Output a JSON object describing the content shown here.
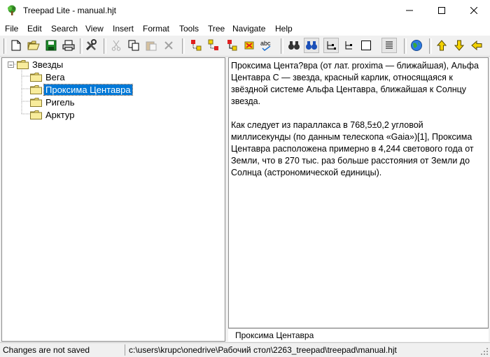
{
  "window": {
    "title": "Treepad Lite - manual.hjt"
  },
  "menu": [
    "File",
    "Edit",
    "Search",
    "View",
    "Insert",
    "Format",
    "Tools",
    "Tree",
    "Navigate",
    "Help"
  ],
  "toolbar": {
    "icons": [
      "new-file-icon",
      "open-folder-icon",
      "save-icon",
      "print-icon",
      "tools-icon",
      "cut-icon",
      "copy-icon",
      "paste-icon",
      "delete-icon",
      "insert-node-before-icon",
      "insert-node-after-icon",
      "insert-child-icon",
      "delete-node-icon",
      "spellcheck-icon",
      "find-icon",
      "find-next-icon",
      "tree-layout-icon",
      "tree-layout-2-icon",
      "single-pane-icon",
      "article-pane-icon",
      "web-icon",
      "move-up-icon",
      "move-down-icon",
      "move-left-icon"
    ],
    "spellcheck_label": "abc"
  },
  "tree": {
    "root": "Звезды",
    "children": [
      "Вега",
      "Проксима Центавра",
      "Ригель",
      "Арктур"
    ],
    "selected": "Проксима Центавра",
    "expander": "−"
  },
  "article": {
    "paragraphs": [
      "Проксима Цента?вра (от лат. proxima — ближайшая), Альфа Центавра C — звезда, красный карлик, относящаяся к звёздной системе Альфа Центавра, ближайшая к Солнцу звезда.",
      "Как следует из параллакса в 768,5±0,2 угловой миллисекунды (по данным телескопа «Gaia»)[1], Проксима Центавра расположена примерно в 4,244 светового года от Земли, что в 270 тыс. раз больше расстояния от Земли до Солнца (астрономической единицы)."
    ]
  },
  "node_caption": "Проксима Центавра",
  "status": {
    "left": "Changes are not saved",
    "path": "c:\\users\\krupc\\onedrive\\Рабочий стол\\2263_treepad\\treepad\\manual.hjt"
  },
  "colors": {
    "selection": "#0078d7",
    "folder": "#f5e27a",
    "accent_arrows": "#f2d100"
  }
}
